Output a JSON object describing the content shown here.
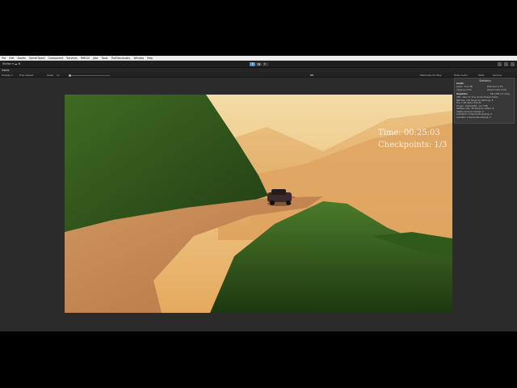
{
  "menu": [
    "File",
    "Edit",
    "Assets",
    "GameObject",
    "Component",
    "Services",
    "MMGUI",
    "Jobs",
    "Tools",
    "TheFabulousity",
    "Window",
    "Help"
  ],
  "toolbar": {
    "account": "Stefan ▾   ☁  ⚙"
  },
  "tab": {
    "label": "Game"
  },
  "game_bar": {
    "display": "Display 1",
    "aspect": "Free Aspect",
    "scale_label": "Scale",
    "scale_value": "1x",
    "maximize": "Maximize On Play",
    "mute": "Mute Audio",
    "stats": "Stats",
    "gizmos": "Gizmos"
  },
  "hud": {
    "time": "Time: 00:25:03",
    "checkpoints": "Checkpoints: 1/3"
  },
  "stats_panel": {
    "title": "Statistics",
    "audio_header": "Audio:",
    "audio_level": "Level: -74.4 dB",
    "audio_clipping": "Clipping: 0.0%",
    "dsp_load": "DSP load: 0.2%",
    "stream_load": "Stream load: 0.0%",
    "graphics_header": "Graphics:",
    "fps": "58.4 FPS (17.1ms)",
    "cpu": "CPU: main 17.1ms  render thread 3.8ms",
    "batches": "Batches: 104  Saved by batching: 6",
    "tris": "Tris: 1.2M  Verts: 832.4k",
    "screen": "Screen: 1920x1080 - 23.7 MB",
    "setpass": "SetPass calls: 38  Shadow casters: 9",
    "skinned": "Visible skinned meshes: 0",
    "animations": "Animation components playing: 0",
    "animators": "Animator components playing: 0"
  },
  "colors": {
    "sky_top": "#f3d9a0",
    "sky_horizon": "#e9b466",
    "grass_dark": "#1c3a14",
    "grass_light": "#4f7a2b",
    "road": "#c98a55",
    "editor_bg": "#2b2b2b",
    "play_blue": "#4b8fd9"
  }
}
